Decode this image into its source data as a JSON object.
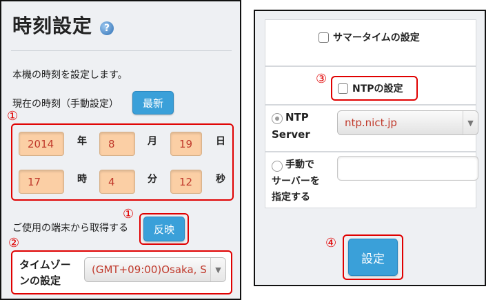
{
  "left": {
    "title": "時刻設定",
    "help_icon": "?",
    "description": "本機の時刻を設定します。",
    "current_time_label": "現在の時刻（手動設定）",
    "refresh_button": "最新",
    "annotation_1": "①",
    "annotation_1b": "①",
    "annotation_2": "②",
    "date": {
      "year": "2014",
      "year_unit": "年",
      "month": "8",
      "month_unit": "月",
      "day": "19",
      "day_unit": "日"
    },
    "time": {
      "hour": "17",
      "hour_unit": "時",
      "minute": "4",
      "minute_unit": "分",
      "second": "12",
      "second_unit": "秒"
    },
    "device_label": "ご使用の端末から取得する",
    "apply_button": "反映",
    "timezone_label_line1": "タイムゾー",
    "timezone_label_line2": "ンの設定",
    "timezone_value": "(GMT+09:00)Osaka, S"
  },
  "right": {
    "dst_label": "サマータイムの設定",
    "annotation_3": "③",
    "ntp_label": "NTPの設定",
    "ntp_server_line1": "NTP",
    "ntp_server_line2": "Server",
    "ntp_server_value": "ntp.nict.jp",
    "manual_line1": "手動で",
    "manual_line2": "サーバーを",
    "manual_line3": "指定する",
    "annotation_4": "④",
    "submit_button": "設定"
  },
  "colors": {
    "accent_blue": "#3aa0d9",
    "field_orange": "#fbcfa5",
    "annotation_red": "#e00000",
    "value_red": "#c0392b"
  }
}
